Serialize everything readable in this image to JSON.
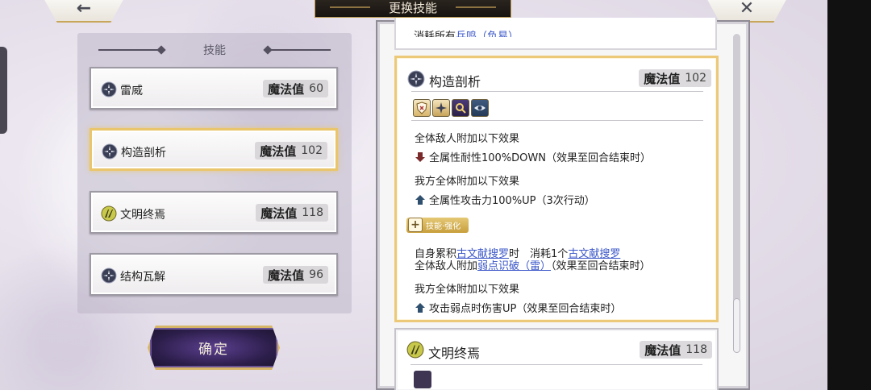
{
  "header": {
    "title": "更换技能",
    "back_icon": "←",
    "close_icon": "✕"
  },
  "left_panel": {
    "header_label": "技能",
    "skills": [
      {
        "name": "雷威",
        "mp_label": "魔法值",
        "mp": "60",
        "icon": "gear-icon",
        "selected": false
      },
      {
        "name": "构造剖析",
        "mp_label": "魔法值",
        "mp": "102",
        "icon": "gear-icon",
        "selected": true
      },
      {
        "name": "文明终焉",
        "mp_label": "魔法值",
        "mp": "118",
        "icon": "slash-icon",
        "selected": false
      },
      {
        "name": "结构瓦解",
        "mp_label": "魔法值",
        "mp": "96",
        "icon": "gear-icon",
        "selected": false
      }
    ],
    "confirm_label": "确定"
  },
  "detail": {
    "prev_card_text": {
      "prefix": "消耗所有",
      "link": "兵鸣（负易）"
    },
    "main": {
      "name": "构造剖析",
      "mp_label": "魔法值",
      "mp": "102",
      "status_icons": [
        "shield-down-icon",
        "burst-icon",
        "search-icon",
        "eye-icon"
      ],
      "block1_title": "全体敌人附加以下效果",
      "block1_effect": "全属性耐性100%DOWN（效果至回合结束时）",
      "block2_title": "我方全体附加以下效果",
      "block2_effect": "全属性攻击力100%UP（3次行动）",
      "enhance_label": "技能·强化",
      "enh_line1": {
        "a": "自身累积",
        "link1": "古文献搜罗",
        "b": "时　消耗1个",
        "link2": "古文献搜罗"
      },
      "enh_line2": {
        "a": "全体敌人附加",
        "link": "弱点识破（雷）",
        "b": "（效果至回合结束时）"
      },
      "block3_title": "我方全体附加以下效果",
      "block3_effect": "攻击弱点时伤害UP（效果至回合结束时）"
    },
    "next": {
      "name": "文明终焉",
      "mp_label": "魔法值",
      "mp": "118"
    }
  },
  "colors": {
    "accent_gold": "#ecc979",
    "link_blue": "#3a56c8",
    "down_arrow": "#7a2a2a",
    "up_arrow": "#2f4f6e",
    "confirm_purple": "#2c1e4b"
  }
}
